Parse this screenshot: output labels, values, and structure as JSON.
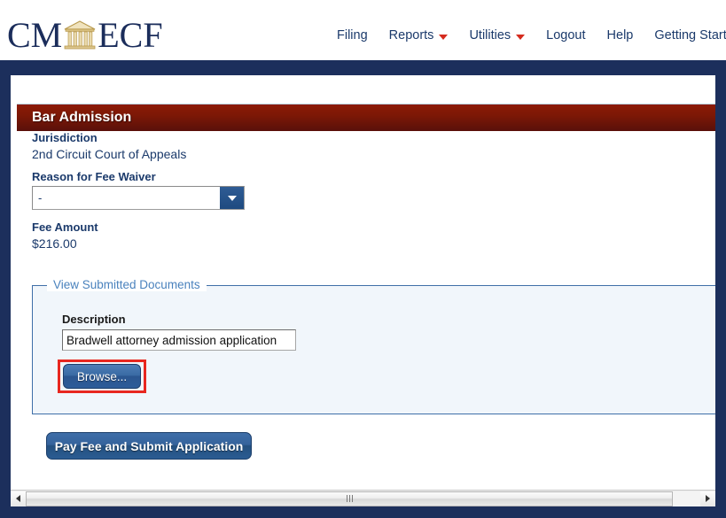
{
  "header": {
    "logo": {
      "text_left": "CM",
      "text_right": "ECF",
      "icon": "courthouse-icon"
    },
    "nav": [
      {
        "label": "Filing",
        "has_caret": false
      },
      {
        "label": "Reports",
        "has_caret": true
      },
      {
        "label": "Utilities",
        "has_caret": true
      },
      {
        "label": "Logout",
        "has_caret": false
      },
      {
        "label": "Help",
        "has_caret": false
      },
      {
        "label": "Getting Started",
        "has_caret": false
      }
    ]
  },
  "section": {
    "title": "Bar Admission"
  },
  "form": {
    "jurisdiction_label": "Jurisdiction",
    "jurisdiction_value": "2nd Circuit Court of Appeals",
    "waiver_label": "Reason for Fee Waiver",
    "waiver_value": "-",
    "fee_label": "Fee Amount",
    "fee_value": "$216.00"
  },
  "documents": {
    "legend": "View Submitted Documents",
    "description_label": "Description",
    "description_value": "Bradwell attorney admission application",
    "description_placeholder": "",
    "browse_label": "Browse..."
  },
  "actions": {
    "submit_label": "Pay Fee and Submit Application"
  },
  "scrollbar": {
    "left_arrow": "scroll-left-icon",
    "right_arrow": "scroll-right-icon"
  },
  "colors": {
    "navy_frame": "#1c2f5c",
    "section_header_red": "#7d1806",
    "link_navy": "#1b3a6b",
    "caret_red": "#d52b1e",
    "fieldset_border": "#3f6fa8",
    "fieldset_bg": "#f1f6fb",
    "legend_blue": "#4a82bd",
    "button_blue": "#2d5c99",
    "annotation_red": "#e8271f",
    "logo_gold": "#c9a košt"
  }
}
